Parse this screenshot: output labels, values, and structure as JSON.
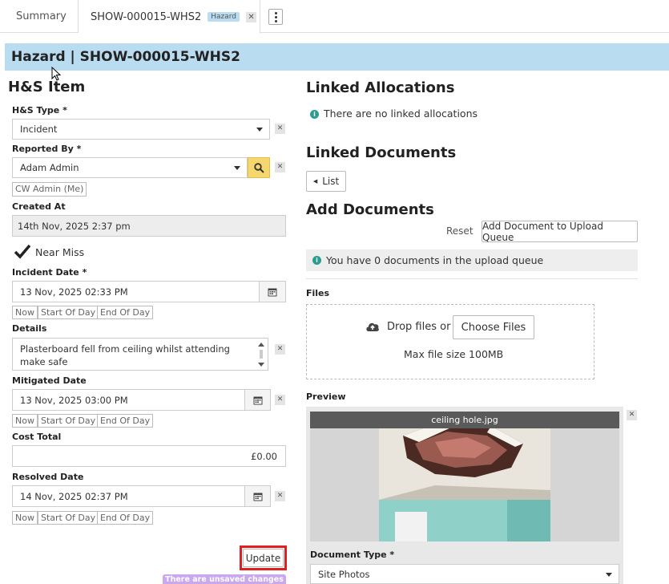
{
  "tabs": {
    "summary": "Summary",
    "active": "SHOW-000015-WHS2",
    "badge": "Hazard"
  },
  "banner": {
    "title": "Hazard | SHOW-000015-WHS2"
  },
  "left": {
    "heading": "H&S Item",
    "hs_type": {
      "label": "H&S Type *",
      "value": "Incident"
    },
    "reported_by": {
      "label": "Reported By *",
      "value": "Adam Admin",
      "me_chip": "CW Admin (Me)"
    },
    "created_at": {
      "label": "Created At",
      "value": "14th Nov, 2025 2:37 pm"
    },
    "near_miss": {
      "label": "Near Miss",
      "checked": true
    },
    "incident_date": {
      "label": "Incident Date *",
      "value": "13 Nov, 2025 02:33 PM"
    },
    "details": {
      "label": "Details",
      "value": "Plasterboard fell from ceiling whilst attending make safe"
    },
    "mitigated_date": {
      "label": "Mitigated Date",
      "value": "13 Nov, 2025 03:00 PM"
    },
    "cost_total": {
      "label": "Cost Total",
      "value": "£0.00"
    },
    "resolved_date": {
      "label": "Resolved Date",
      "value": "14 Nov, 2025 02:37 PM"
    },
    "quick": {
      "now": "Now",
      "start": "Start Of Day",
      "end": "End Of Day"
    },
    "update_button": "Update",
    "unsaved": "There are unsaved changes"
  },
  "right": {
    "linked_allocations": {
      "heading": "Linked Allocations",
      "empty": "There are no linked allocations"
    },
    "linked_documents": {
      "heading": "Linked Documents",
      "list_button": "List"
    },
    "add_documents": {
      "heading": "Add Documents",
      "reset": "Reset",
      "add_queue": "Add Document to Upload Queue",
      "queue_status": "You have 0 documents in the upload queue"
    },
    "files": {
      "label": "Files",
      "drop_text": "Drop files or",
      "choose": "Choose Files",
      "max": "Max file size 100MB"
    },
    "preview": {
      "label": "Preview",
      "filename": "ceiling hole.jpg"
    },
    "document_type": {
      "label": "Document Type *",
      "value": "Site Photos"
    }
  },
  "colors": {
    "banner": "#b9dcf0",
    "accent": "#f5d76e",
    "info": "#2a9d8f",
    "highlight": "#e02020",
    "unsaved": "#c9a8f0"
  }
}
